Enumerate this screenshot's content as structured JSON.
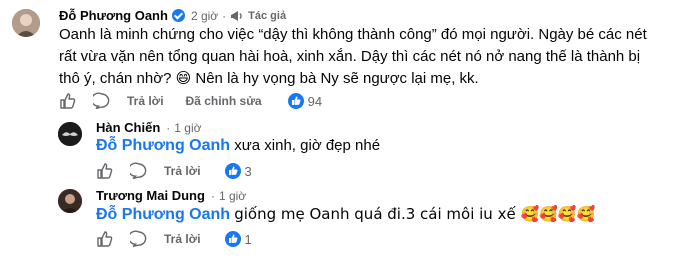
{
  "comment": {
    "author": "Đỗ Phương Oanh",
    "time": "2 giờ",
    "separator": "·",
    "badge": "Tác giả",
    "lines": [
      "Oanh là minh chứng cho việc “dậy thì không thành công” đó mọi người. Ngày bé các nét",
      "rất vừa vặn nên tổng quan hài hoà, xinh xắn. Dậy thì các nét nó nở nang thế là thành bị",
      "thô ý, chán nhờ? 😄 Nên là hy vọng bà Ny sẽ ngược lại mẹ, kk."
    ],
    "reply_label": "Trả lời",
    "edited_label": "Đã chỉnh sửa",
    "likes": "94"
  },
  "replies": [
    {
      "author": "Hàn Chiến",
      "time": "1 giờ",
      "mention": "Đỗ Phương Oanh",
      "text": "xưa xinh, giờ đẹp nhé",
      "reply_label": "Trả lời",
      "likes": "3"
    },
    {
      "author": "Trương Mai Dung",
      "time": "1 giờ",
      "mention": "Đỗ Phương Oanh",
      "text": "giống mẹ Oanh quá đi.3 cái môi iu xế 🥰🥰🥰🥰",
      "reply_label": "Trả lời",
      "likes": "1"
    }
  ],
  "icons": {
    "like": "thumbs-up-icon",
    "comment": "comment-icon",
    "share": "share-icon",
    "badge": "author-badge-icon"
  },
  "colors": {
    "brand": "#1877f2",
    "muted": "#65676b"
  }
}
